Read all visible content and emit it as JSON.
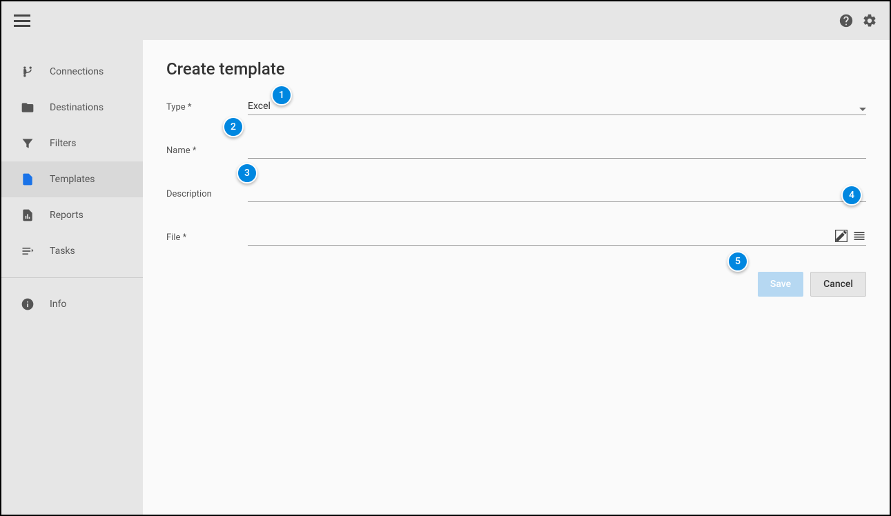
{
  "sidebar": {
    "items": [
      {
        "label": "Connections",
        "icon": "branch-icon"
      },
      {
        "label": "Destinations",
        "icon": "folder-icon"
      },
      {
        "label": "Filters",
        "icon": "filter-icon"
      },
      {
        "label": "Templates",
        "icon": "file-icon"
      },
      {
        "label": "Reports",
        "icon": "chart-icon"
      },
      {
        "label": "Tasks",
        "icon": "tasks-icon"
      }
    ],
    "info_label": "Info"
  },
  "page": {
    "title": "Create template",
    "labels": {
      "type": "Type *",
      "name": "Name *",
      "description": "Description",
      "file": "File *"
    },
    "type_value": "Excel",
    "name_value": "",
    "description_value": "",
    "file_value": ""
  },
  "buttons": {
    "save": "Save",
    "cancel": "Cancel"
  },
  "callouts": {
    "1": "1",
    "2": "2",
    "3": "3",
    "4": "4",
    "5": "5"
  }
}
